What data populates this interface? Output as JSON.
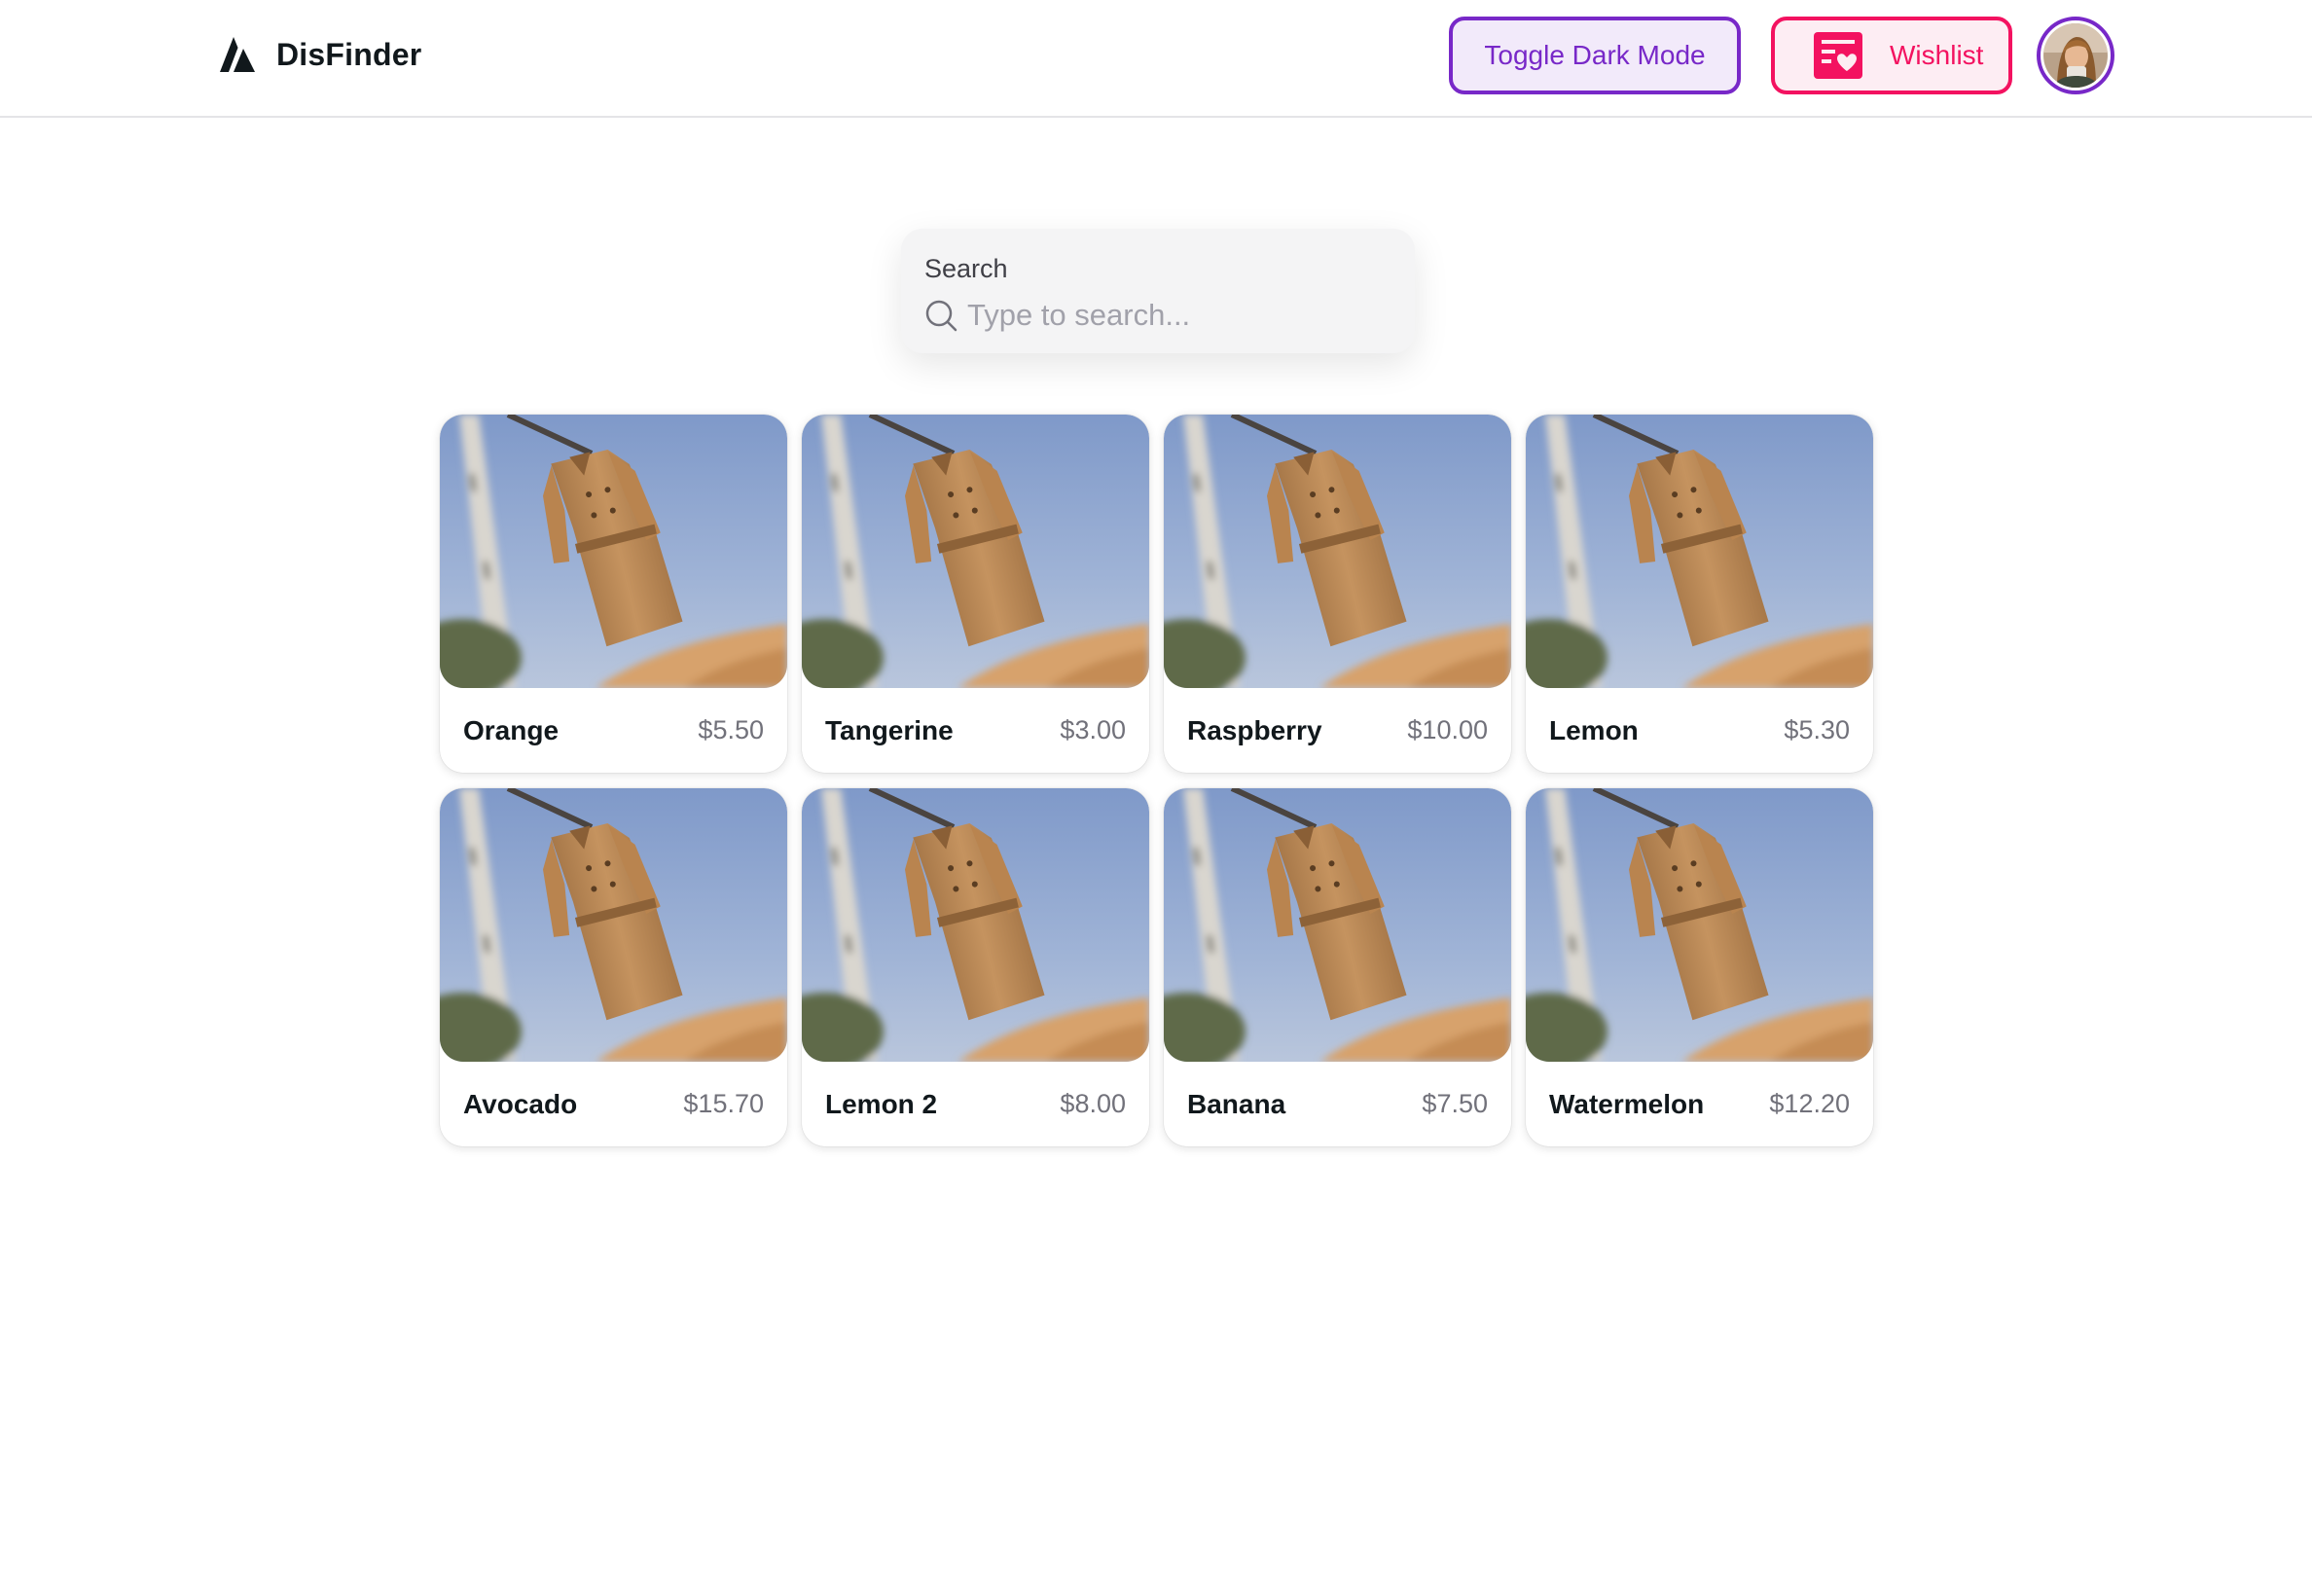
{
  "brand": {
    "name": "DisFinder",
    "logo_icon": "triangle-logo-icon"
  },
  "header": {
    "toggle_dark_mode_label": "Toggle Dark Mode",
    "wishlist_label": "Wishlist",
    "wishlist_icon": "wishlist-heart-icon",
    "avatar_icon": "user-avatar"
  },
  "search": {
    "label": "Search",
    "placeholder": "Type to search...",
    "value": "",
    "icon": "search-icon"
  },
  "products": [
    {
      "name": "Orange",
      "price": "$5.50"
    },
    {
      "name": "Tangerine",
      "price": "$3.00"
    },
    {
      "name": "Raspberry",
      "price": "$10.00"
    },
    {
      "name": "Lemon",
      "price": "$5.30"
    },
    {
      "name": "Avocado",
      "price": "$15.70"
    },
    {
      "name": "Lemon 2",
      "price": "$8.00"
    },
    {
      "name": "Banana",
      "price": "$7.50"
    },
    {
      "name": "Watermelon",
      "price": "$12.20"
    }
  ],
  "colors": {
    "primary": "#7828c8",
    "danger": "#f31260",
    "text": "#11181c",
    "muted": "#71717a"
  }
}
